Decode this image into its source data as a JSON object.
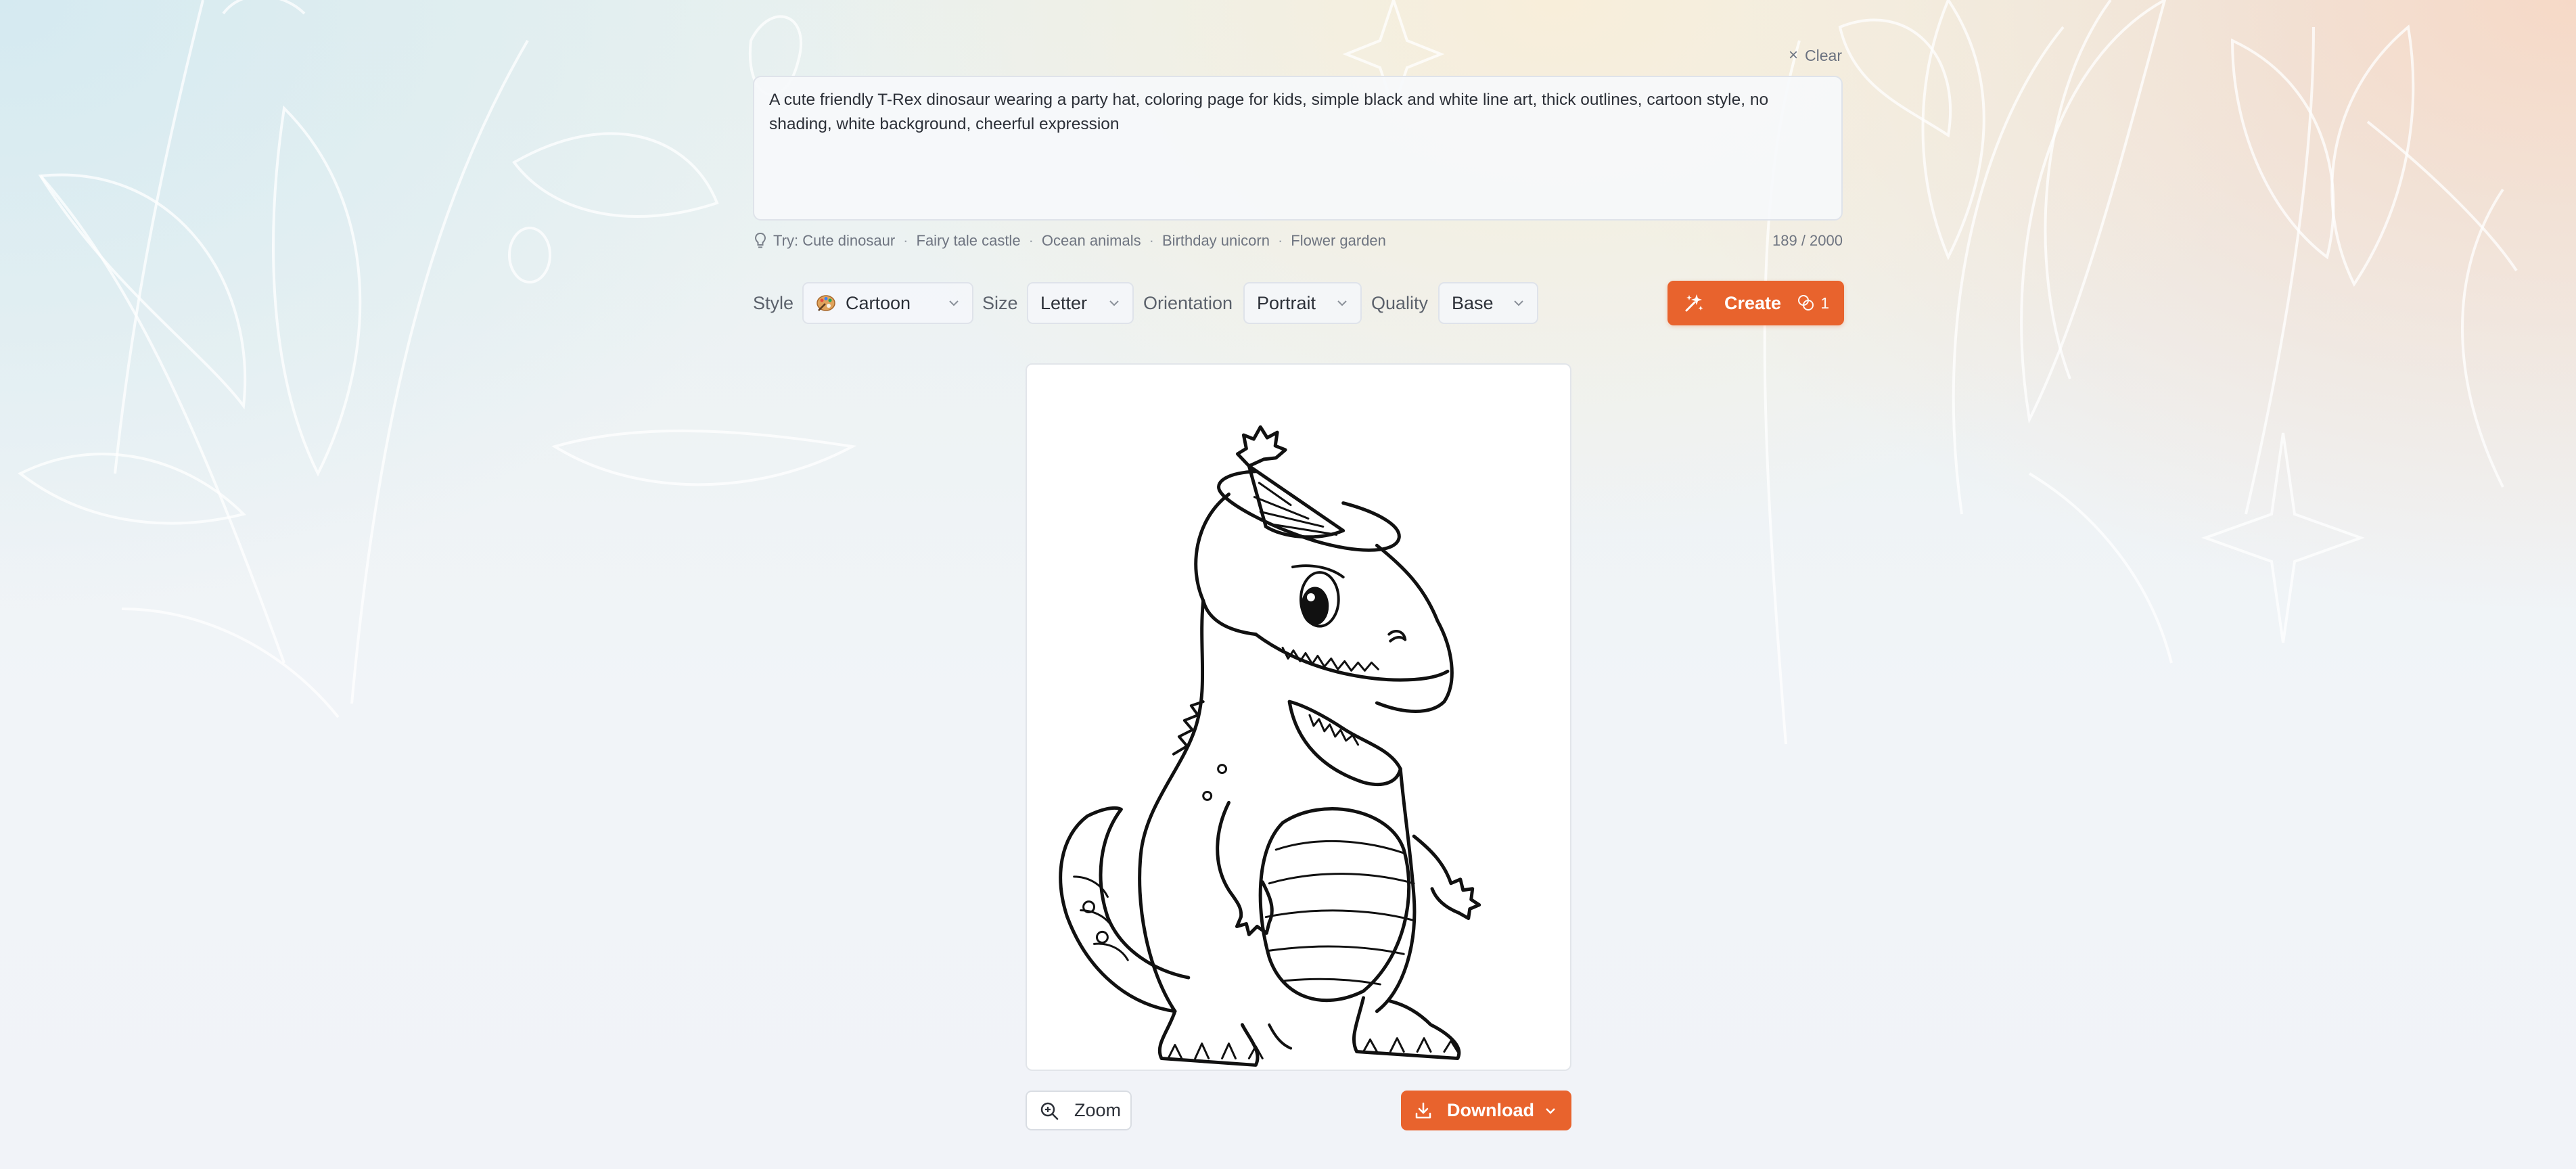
{
  "header": {
    "clear_label": "Clear"
  },
  "prompt": {
    "text": "A cute friendly T-Rex dinosaur wearing a party hat, coloring page for kids, simple black and white line art, thick outlines, cartoon style, no shading, white background, cheerful expression",
    "char_count": "189 / 2000"
  },
  "tips": {
    "prefix": "Try:",
    "suggestions": [
      "Cute dinosaur",
      "Fairy tale castle",
      "Ocean animals",
      "Birthday unicorn",
      "Flower garden"
    ]
  },
  "options": {
    "style_label": "Style",
    "style_value": "Cartoon",
    "size_label": "Size",
    "size_value": "Letter",
    "orientation_label": "Orientation",
    "orientation_value": "Portrait",
    "quality_label": "Quality",
    "quality_value": "Base"
  },
  "create": {
    "label": "Create",
    "credits": "1"
  },
  "actions": {
    "zoom_label": "Zoom",
    "download_label": "Download"
  },
  "icons": {
    "clear": "close-icon",
    "tip": "lightbulb-icon",
    "style": "palette-icon",
    "dropdown": "chevron-down-icon",
    "create": "sparkles-icon",
    "credits": "coins-icon",
    "zoom": "zoom-in-icon",
    "download": "download-icon"
  },
  "colors": {
    "accent": "#e8632d",
    "text": "#2c3038",
    "muted": "#6e7480",
    "border": "#dfe3ea"
  }
}
